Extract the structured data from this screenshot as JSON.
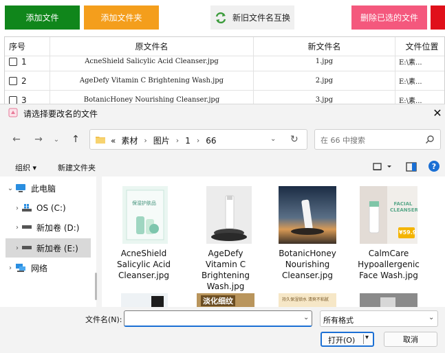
{
  "toolbar": {
    "add_file": "添加文件",
    "add_folder": "添加文件夹",
    "swap_names": "新旧文件名互换",
    "delete_selected": "删除已选的文件",
    "colors": {
      "add_file": "#10861b",
      "add_folder": "#f49e1c",
      "delete": "#f4587d",
      "red": "#e0101a"
    }
  },
  "grid": {
    "headers": [
      "序号",
      "原文件名",
      "新文件名",
      "文件位置"
    ],
    "rows": [
      {
        "index": "1",
        "original": "AcneShield Salicylic Acid Cleanser.jpg",
        "new": "1.jpg",
        "location": "E:\\素..."
      },
      {
        "index": "2",
        "original": "AgeDefy Vitamin C Brightening Wash.jpg",
        "new": "2.jpg",
        "location": "E:\\素..."
      },
      {
        "index": "3",
        "original": "BotanicHoney Nourishing Cleanser.jpg",
        "new": "3.jpg",
        "location": "E:\\素..."
      }
    ]
  },
  "dialog": {
    "title": "请选择要改名的文件",
    "close_icon": "close-icon",
    "address": {
      "prefix": "«",
      "crumbs": [
        "素材",
        "图片",
        "1",
        "66"
      ]
    },
    "search_placeholder": "在 66 中搜索",
    "commands": {
      "organize": "组织 ▾",
      "new_folder": "新建文件夹"
    },
    "help": "?",
    "tree": [
      {
        "label": "此电脑",
        "icon": "pc-icon",
        "expanded": true
      },
      {
        "label": "OS (C:)",
        "icon": "windows-drive-icon"
      },
      {
        "label": "新加卷 (D:)",
        "icon": "drive-icon"
      },
      {
        "label": "新加卷 (E:)",
        "icon": "drive-icon",
        "selected": true
      },
      {
        "label": "网络",
        "icon": "network-icon"
      }
    ],
    "files": [
      {
        "name_lines": [
          "AcneShield",
          "Salicylic Acid",
          "Cleanser.jpg"
        ]
      },
      {
        "name_lines": [
          "AgeDefy",
          "Vitamin C",
          "Brightening",
          "Wash.jpg"
        ]
      },
      {
        "name_lines": [
          "BotanicHoney",
          "Nourishing",
          "Cleanser.jpg"
        ]
      },
      {
        "name_lines": [
          "CalmCare",
          "Hypoallergenic",
          "Face Wash.jpg"
        ]
      }
    ],
    "thumb_texts": {
      "t1": "保湿护肤品",
      "t4_title": "FACIAL CLEANSER",
      "t4_price": "¥59.9",
      "r2": "淡化细纹",
      "r3": "持久保湿锁水 清爽不粘腻"
    },
    "filename_label": "文件名(N):",
    "filename_value": "",
    "filter": "所有格式",
    "open": "打开(O)",
    "cancel": "取消"
  }
}
